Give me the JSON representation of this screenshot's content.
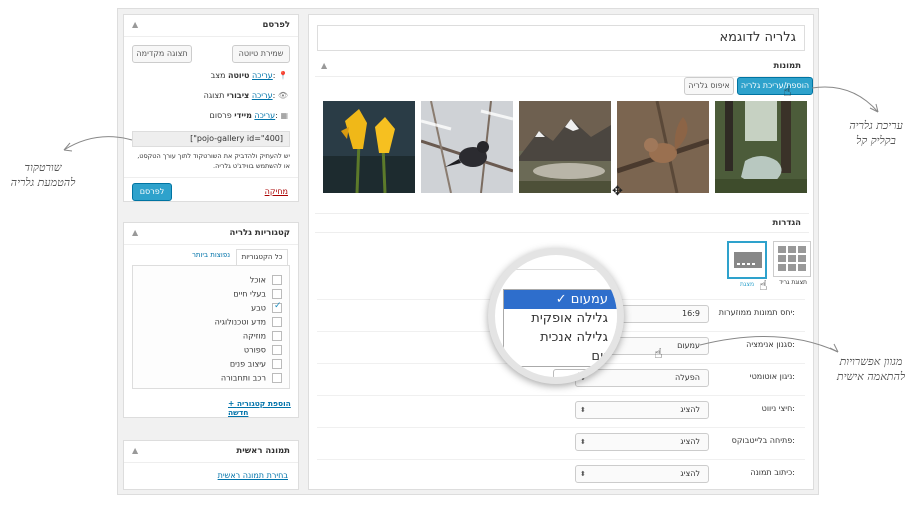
{
  "main": {
    "title": "גלריה לדוגמא",
    "images_section": "תמונות",
    "add_edit_button": "הוספת/עריכת גלריה",
    "reset_button": "איפוס גלריה",
    "settings_section": "הגדרות",
    "layouts": [
      {
        "label": "תצוגת גריד",
        "icon": "grid-layout-icon"
      },
      {
        "label": "מצגת",
        "icon": "slideshow-layout-icon"
      }
    ],
    "settings": [
      {
        "label": "יחס תמונות ממוזערות:",
        "value": "16:9"
      },
      {
        "label": "סגנון אנימציה:",
        "value": "עמעום"
      },
      {
        "label": "ניגון אוטומטי:",
        "value": "הפעלה"
      },
      {
        "label": "חיצי ניווט:",
        "value": "להציג"
      },
      {
        "label": "פתיחה בלייטבוקס:",
        "value": "להציג"
      },
      {
        "label": "כיתוב תמונה:",
        "value": "להציג"
      }
    ],
    "animation_options": [
      {
        "label": "✓ עמעום",
        "selected": true
      },
      {
        "label": "גלילה אופקית",
        "selected": false
      },
      {
        "label": "גלילה אנכית",
        "selected": false
      },
      {
        "label": "זום",
        "selected": false
      }
    ],
    "partial_button": "להצי"
  },
  "publish": {
    "title": "לפרסם",
    "save_draft": "שמירת טיוטה",
    "preview": "תצוגה מקדימה",
    "status_label": "מצב:",
    "status_value": "טיוטה",
    "visibility_label": "תצוגה:",
    "visibility_value": "ציבורי",
    "publish_label": "פרסום:",
    "publish_value": "מיידי",
    "edit_link": "עריכה",
    "shortcode": "[\"pojo-gallery id=\"400]",
    "shortcode_help": "יש להעתיק ולהדביק את השורטקוד לתוך עורך הטקסט, או להשתמש בווידג'ט גלריה.",
    "delete_link": "מחיקה",
    "publish_button": "לפרסם"
  },
  "categories": {
    "title": "קטגוריות גלריה",
    "tab_all": "כל הקטגוריות",
    "tab_popular": "נפוצות ביותר",
    "items": [
      {
        "label": "אוכל",
        "checked": false
      },
      {
        "label": "בעלי חיים",
        "checked": false
      },
      {
        "label": "טבע",
        "checked": true
      },
      {
        "label": "מדע וטכנולוגיה",
        "checked": false
      },
      {
        "label": "מוזיקה",
        "checked": false
      },
      {
        "label": "ספורט",
        "checked": false
      },
      {
        "label": "עיצוב פנים",
        "checked": false
      },
      {
        "label": "רכב ותחבורה",
        "checked": false
      }
    ],
    "add_new": "+ הוספת קטגוריה חדשה"
  },
  "featured": {
    "title": "תמונה ראשית",
    "choose_link": "בחירת תמונה ראשית"
  },
  "annotations": {
    "left": [
      "שורטקוד",
      "להטמעת גלריה"
    ],
    "right_top": [
      "עריכת גלריה",
      "בקליק קל"
    ],
    "right_bottom": [
      "מגוון אפשרויות",
      "להתאמה אישית"
    ]
  },
  "colors": {
    "accent": "#2ea2cc",
    "link": "#0073aa",
    "delete": "#a00",
    "selected": "#2e6ecc"
  }
}
